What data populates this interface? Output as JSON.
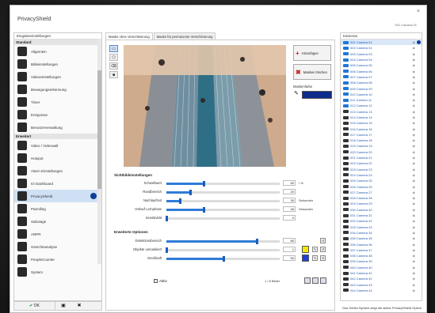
{
  "window": {
    "title": "PrivacyShield",
    "camera_id": "001 Camera 01",
    "close": "×"
  },
  "nav": {
    "header": "Eingabeeinstellungen",
    "section_standard": "Standard",
    "section_erweitert": "Erweitert",
    "items_standard": [
      {
        "label": "Allgemein",
        "icon": "gear-icon"
      },
      {
        "label": "Bildeinstellungen",
        "icon": "image-icon"
      },
      {
        "label": "Videoeinstellungen",
        "icon": "video-icon"
      },
      {
        "label": "Bewegungserkennung",
        "icon": "motion-icon"
      },
      {
        "label": "Timer",
        "icon": "clock-icon"
      },
      {
        "label": "Ereignisse",
        "icon": "event-icon"
      },
      {
        "label": "Benutzerverwaltung",
        "icon": "users-icon"
      }
    ],
    "items_erweitert": [
      {
        "label": "Video / Videowall",
        "icon": "monitor-icon"
      },
      {
        "label": "Hotspot",
        "icon": "hotspot-icon"
      },
      {
        "label": "Alarm Einstellungen",
        "icon": "alarm-icon"
      },
      {
        "label": "IO Dashboard",
        "icon": "io-icon"
      },
      {
        "label": "PrivacyShield",
        "icon": "shield-icon",
        "active": true
      },
      {
        "label": "Patrolling",
        "icon": "patrol-icon"
      },
      {
        "label": "Sabotage",
        "icon": "sabotage-icon"
      },
      {
        "label": "ANPR",
        "icon": "car-icon"
      },
      {
        "label": "Gesichtsanalyse",
        "icon": "face-icon"
      },
      {
        "label": "PeopleCounter",
        "icon": "people-icon"
      },
      {
        "label": "System",
        "icon": "system-icon"
      }
    ],
    "ok_label": "OK"
  },
  "tabs": [
    "Maske ohne Verschleierung",
    "Maske für permanente Verschleierung"
  ],
  "side_buttons": {
    "insert": "Hinzufügen",
    "delete_all": "Masken löschen"
  },
  "mask_color_label": "Maskenfarbe",
  "colors": {
    "mask": "#0e2c8c",
    "accent": "#2f7bd8",
    "swatch_yellow": "#f2e600",
    "swatch_blue": "#1f3fd6"
  },
  "image_settings": {
    "header": "Sichtbildeinstellungen",
    "rows": [
      {
        "label": "Schwellwert",
        "value": "50",
        "pct": 0.33,
        "suffix": "/ %"
      },
      {
        "label": "Randbereich",
        "value": "20",
        "pct": 0.21,
        "suffix": ""
      },
      {
        "label": "Nachlaufzeit",
        "value": "30",
        "pct": 0.12,
        "suffix": "Sekunden"
      },
      {
        "label": "Vorlauf Lernphase",
        "value": "45",
        "pct": 0.33,
        "suffix": "Sekunden"
      },
      {
        "label": "Sensitivität",
        "value": "0",
        "pct": 0.0,
        "suffix": ""
      }
    ]
  },
  "extended": {
    "header": "Erweiterte Optionen",
    "rows": [
      {
        "label": "Detektionsbereich",
        "value": "80",
        "pct": 0.8
      },
      {
        "label": "Objekte unmaskiert",
        "value": "1",
        "pct": 0.0
      },
      {
        "label": "Deckkraft",
        "value": "50",
        "pct": 0.5
      }
    ]
  },
  "bottom": {
    "checkbox": "Aktiv",
    "pager": "1 / 8 Bilder"
  },
  "cameras": {
    "header": "Kameras",
    "items": [
      {
        "name": "001 Camera 01",
        "icon": "blue",
        "selected": true,
        "shield": true
      },
      {
        "name": "002 Camera 02",
        "icon": "blue"
      },
      {
        "name": "003 Camera 03",
        "icon": "blue"
      },
      {
        "name": "004 Camera 04",
        "icon": "blue"
      },
      {
        "name": "005 Camera 05",
        "icon": "blue"
      },
      {
        "name": "006 Camera 06",
        "icon": "blue"
      },
      {
        "name": "007 Camera 07",
        "icon": "blue"
      },
      {
        "name": "008 Camera 08",
        "icon": "blue"
      },
      {
        "name": "009 Camera 09",
        "icon": "blue"
      },
      {
        "name": "010 Camera 10",
        "icon": "blue"
      },
      {
        "name": "011 Camera 11",
        "icon": "blue"
      },
      {
        "name": "012 Camera 12",
        "icon": "blue"
      },
      {
        "name": "013 Camera 13",
        "icon": "dark"
      },
      {
        "name": "014 Camera 14",
        "icon": "dark"
      },
      {
        "name": "015 Camera 15",
        "icon": "dark"
      },
      {
        "name": "016 Camera 16",
        "icon": "dark"
      },
      {
        "name": "017 Camera 17",
        "icon": "dark"
      },
      {
        "name": "018 Camera 18",
        "icon": "dark"
      },
      {
        "name": "019 Camera 19",
        "icon": "dark"
      },
      {
        "name": "020 Camera 20",
        "icon": "dark"
      },
      {
        "name": "021 Camera 21",
        "icon": "dark"
      },
      {
        "name": "022 Camera 22",
        "icon": "dark"
      },
      {
        "name": "023 Camera 23",
        "icon": "dark"
      },
      {
        "name": "024 Camera 24",
        "icon": "dark"
      },
      {
        "name": "025 Camera 25",
        "icon": "dark"
      },
      {
        "name": "026 Camera 26",
        "icon": "dark"
      },
      {
        "name": "027 Camera 27",
        "icon": "dark"
      },
      {
        "name": "028 Camera 28",
        "icon": "dark"
      },
      {
        "name": "029 Camera 29",
        "icon": "dark"
      },
      {
        "name": "030 Camera 30",
        "icon": "dark"
      },
      {
        "name": "031 Camera 31",
        "icon": "dark"
      },
      {
        "name": "032 Camera 32",
        "icon": "dark"
      },
      {
        "name": "033 Camera 33",
        "icon": "dark"
      },
      {
        "name": "034 Camera 34",
        "icon": "dark"
      },
      {
        "name": "035 Camera 35",
        "icon": "dark"
      },
      {
        "name": "036 Camera 36",
        "icon": "dark"
      },
      {
        "name": "037 Camera 37",
        "icon": "dark"
      },
      {
        "name": "038 Camera 38",
        "icon": "dark"
      },
      {
        "name": "039 Camera 39",
        "icon": "dark"
      },
      {
        "name": "040 Camera 40",
        "icon": "dark"
      },
      {
        "name": "041 Camera 41",
        "icon": "dark"
      },
      {
        "name": "042 Camera 42",
        "icon": "dark"
      },
      {
        "name": "043 Camera 43",
        "icon": "dark"
      },
      {
        "name": "044 Camera 44",
        "icon": "dark"
      }
    ]
  },
  "status_bar": "Das Schild-Symbol zeigt die aktive PrivacyShield Option"
}
